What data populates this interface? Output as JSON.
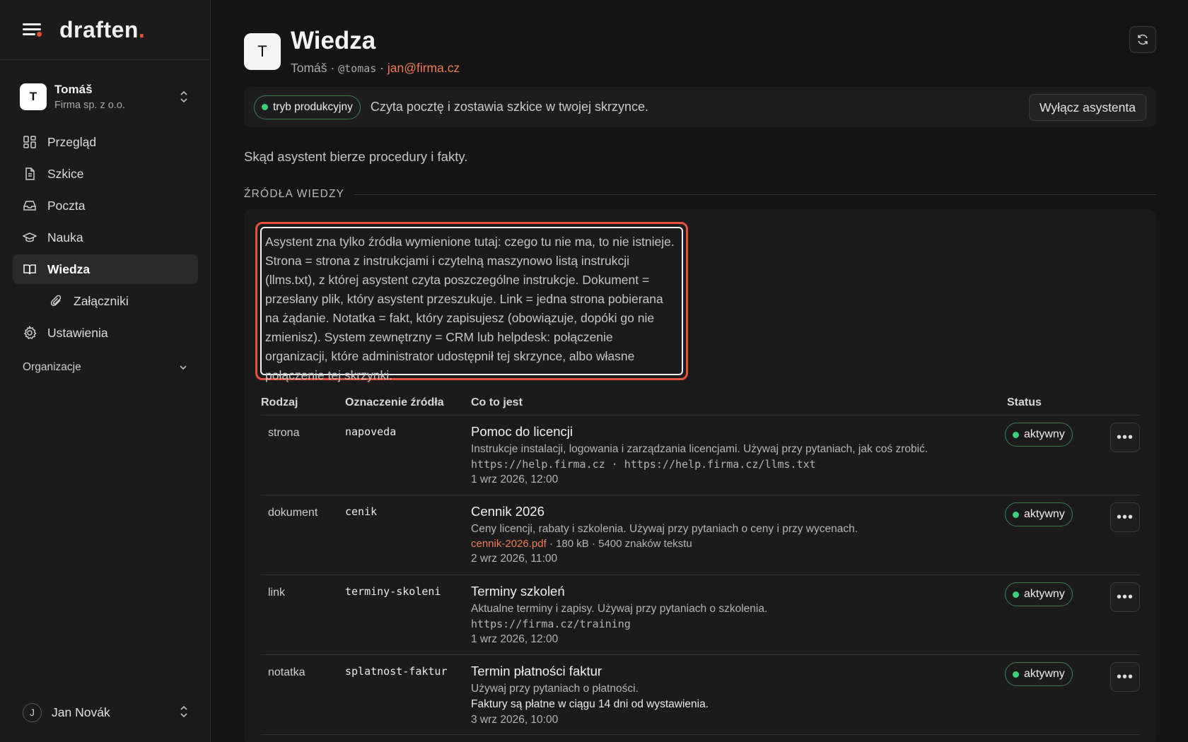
{
  "brand": {
    "name": "draften",
    "dot": "."
  },
  "account": {
    "initial": "T",
    "name": "Tomáš",
    "org": "Firma sp. z o.o."
  },
  "nav": {
    "items": [
      {
        "label": "Przegląd",
        "icon": "grid-icon"
      },
      {
        "label": "Szkice",
        "icon": "document-icon"
      },
      {
        "label": "Poczta",
        "icon": "inbox-icon"
      },
      {
        "label": "Nauka",
        "icon": "graduation-cap-icon"
      },
      {
        "label": "Wiedza",
        "icon": "book-icon",
        "active": true
      },
      {
        "label": "Załączniki",
        "icon": "paperclip-icon",
        "sub": true
      },
      {
        "label": "Ustawienia",
        "icon": "gear-icon"
      }
    ],
    "group": "Organizacje"
  },
  "user": {
    "initial": "J",
    "name": "Jan Novák"
  },
  "header": {
    "initial": "T",
    "title": "Wiedza",
    "name": "Tomáš",
    "sep1": " · ",
    "handle": "@tomas",
    "sep2": " · ",
    "email": "jan@firma.cz"
  },
  "mode": {
    "badge": "tryb produkcyjny",
    "description": "Czyta pocztę i zostawia szkice w twojej skrzynce.",
    "disable_label": "Wyłącz asystenta"
  },
  "lead": "Skąd asystent bierze procedury i fakty.",
  "section_label": "ŹRÓDŁA WIEDZY",
  "callout": "Asystent zna tylko źródła wymienione tutaj: czego tu nie ma, to nie istnieje. Strona = strona z instrukcjami i czytelną maszynowo listą instrukcji (llms.txt), z której asystent czyta poszczególne instrukcje. Dokument = przesłany plik, który asystent przeszukuje. Link = jedna strona pobierana na żądanie. Notatka = fakt, który zapisujesz (obowiązuje, dopóki go nie zmienisz). System zewnętrzny = CRM lub helpdesk: połączenie organizacji, które administrator udostępnił tej skrzynce, albo własne połączenie tej skrzynki.",
  "table": {
    "headers": {
      "kind": "Rodzaj",
      "id": "Oznaczenie źródła",
      "what": "Co to jest",
      "status": "Status"
    },
    "rows": [
      {
        "kind": "strona",
        "id": "napoveda",
        "title": "Pomoc do licencji",
        "desc": "Instrukcje instalacji, logowania i zarządzania licencjami. Używaj przy pytaniach, jak coś zrobić.",
        "meta": "https://help.firma.cz · https://help.firma.cz/llms.txt",
        "date": "1 wrz 2026, 12:00",
        "status": "aktywny"
      },
      {
        "kind": "dokument",
        "id": "cenik",
        "title": "Cennik 2026",
        "desc": "Ceny licencji, rabaty i szkolenia. Używaj przy pytaniach o ceny i przy wycenach.",
        "file": "cennik-2026.pdf",
        "file_meta": " · 180 kB · 5400 znaków tekstu",
        "date": "2 wrz 2026, 11:00",
        "status": "aktywny"
      },
      {
        "kind": "link",
        "id": "terminy-skoleni",
        "title": "Terminy szkoleń",
        "desc": "Aktualne terminy i zapisy. Używaj przy pytaniach o szkolenia.",
        "meta": "https://firma.cz/training",
        "date": "1 wrz 2026, 12:00",
        "status": "aktywny"
      },
      {
        "kind": "notatka",
        "id": "splatnost-faktur",
        "title": "Termin płatności faktur",
        "desc": "Używaj przy pytaniach o płatności.",
        "note": "Faktury są płatne w ciągu 14 dni od wystawienia.",
        "date": "3 wrz 2026, 10:00",
        "status": "aktywny"
      }
    ]
  },
  "colors": {
    "accent": "#e5523a",
    "link": "#ef7a5c",
    "status_green": "#3ecf7a"
  }
}
